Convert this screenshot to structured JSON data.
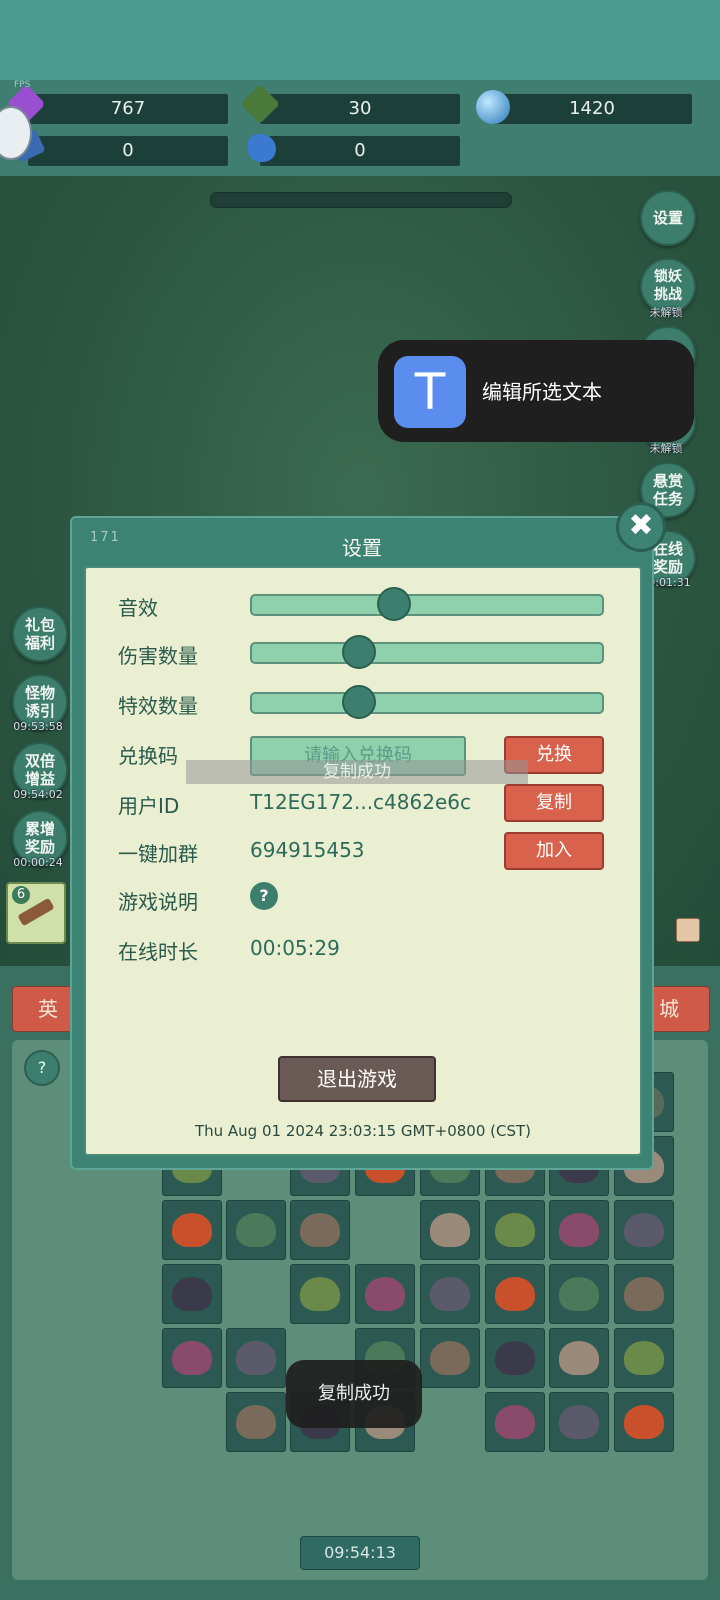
{
  "resources": {
    "gem_purple": "767",
    "crystal_green": "30",
    "orb_blue": "1420",
    "card_blue": "0",
    "fish_blue": "0",
    "fps_label": "FPS"
  },
  "side_right": [
    {
      "label": "设置",
      "sub": ""
    },
    {
      "label": "锁妖挑战",
      "sub": "未解锁"
    },
    {
      "label": "悬赏任务",
      "sub": ""
    },
    {
      "label": "在线奖励",
      "sub": "00:01:31"
    }
  ],
  "side_right_partial": {
    "sub": "未解锁"
  },
  "side_left": [
    {
      "label": "礼包福利",
      "sub": ""
    },
    {
      "label": "怪物诱引",
      "sub": "09:53:58"
    },
    {
      "label": "双倍增益",
      "sub": "09:54:02"
    },
    {
      "label": "累增奖励",
      "sub": "00:00:24"
    }
  ],
  "weapon_badge": "6",
  "tabs": {
    "left": "英",
    "right": "城"
  },
  "help_icon": "?",
  "bottom_timer": "09:54:13",
  "edit_popup": {
    "icon_letter": "T",
    "label": "编辑所选文本"
  },
  "dialog": {
    "number": "171",
    "title": "设置",
    "close": "✖",
    "rows": {
      "sound": "音效",
      "damage": "伤害数量",
      "effects": "特效数量",
      "redeem": "兑换码",
      "user_id": "用户ID",
      "join": "一键加群",
      "guide": "游戏说明",
      "online": "在线时长"
    },
    "sliders": {
      "sound": 0.4,
      "damage": 0.3,
      "effects": 0.3
    },
    "redeem_placeholder": "请输入兑换码",
    "redeem_button": "兑换",
    "user_id_value": "T12EG172...c4862e6c",
    "copy_button": "复制",
    "group_value": "694915453",
    "join_button": "加入",
    "help_glyph": "?",
    "online_value": "00:05:29",
    "exit_button": "退出游戏",
    "datetime": "Thu Aug 01 2024 23:03:15 GMT+0800 (CST)",
    "ghost_toast": "复制成功"
  },
  "toast": "复制成功",
  "colors": {
    "accent_red": "#d8624c",
    "panel_cream": "#e9efd0",
    "teal": "#3d8373"
  }
}
